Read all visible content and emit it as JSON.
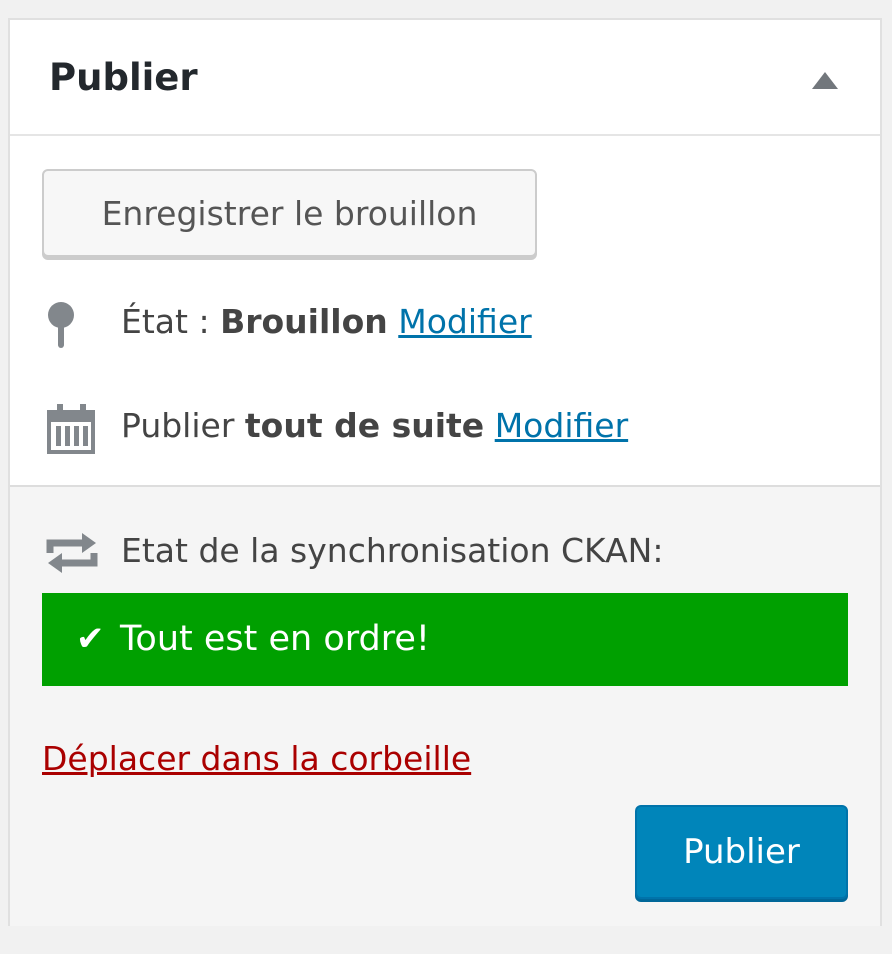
{
  "panel": {
    "title": "Publier"
  },
  "actions": {
    "save_draft_label": "Enregistrer le brouillon",
    "publish_label": "Publier",
    "trash_label": "Déplacer dans la corbeille"
  },
  "status": {
    "label": "État :",
    "value": "Brouillon",
    "edit_label": "Modifier"
  },
  "schedule": {
    "label": "Publier",
    "value": "tout de suite",
    "edit_label": "Modifier"
  },
  "sync": {
    "label": "Etat de la synchronisation CKAN:",
    "message": "Tout est en ordre!",
    "check_glyph": "✔",
    "status_color": "#00a000"
  },
  "colors": {
    "link": "#0073aa",
    "danger_link": "#a00000",
    "primary_button": "#0085ba"
  },
  "icons": {
    "status": "pin-icon",
    "schedule": "calendar-icon",
    "sync": "sync-icon",
    "collapse": "triangle-up-icon",
    "check": "check-icon"
  }
}
